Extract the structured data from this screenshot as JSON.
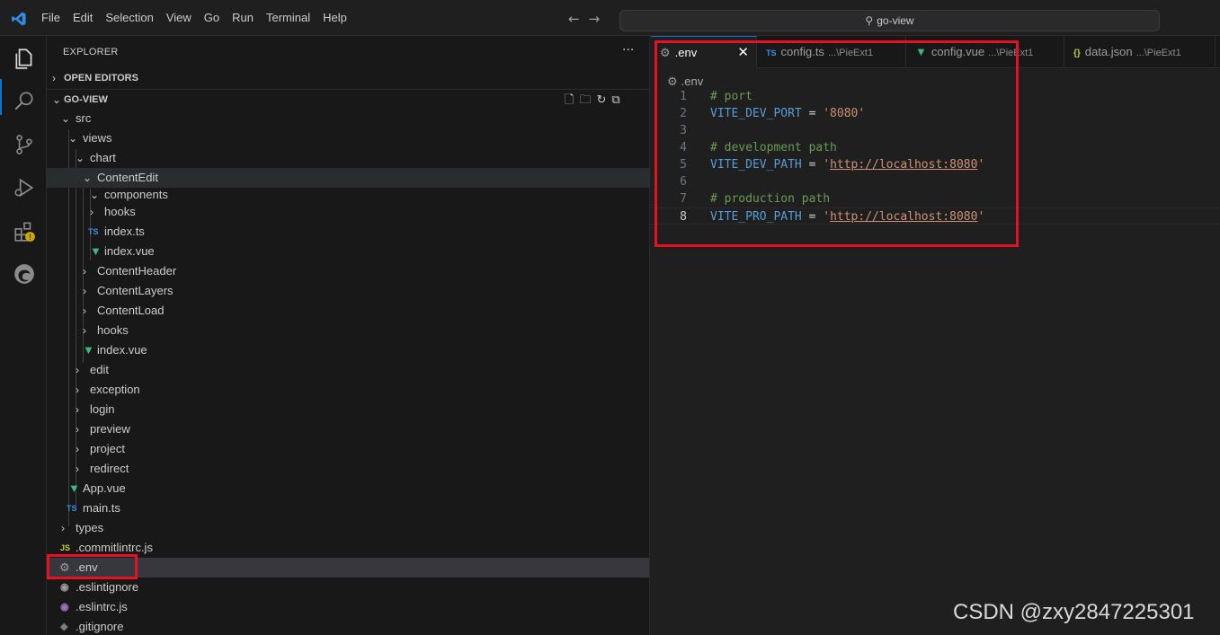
{
  "menu": [
    "File",
    "Edit",
    "Selection",
    "View",
    "Go",
    "Run",
    "Terminal",
    "Help"
  ],
  "search": {
    "text": "go-view"
  },
  "activity_icons": [
    "explorer-icon",
    "search-icon",
    "source-control-icon",
    "run-debug-icon",
    "extensions-icon",
    "edge-icon"
  ],
  "sidebar": {
    "title": "EXPLORER",
    "open_editors": "OPEN EDITORS",
    "project": "GO-VIEW",
    "tree": [
      {
        "name": "src",
        "icon": "chev-down"
      },
      {
        "name": "views",
        "icon": "chev-down"
      },
      {
        "name": "chart",
        "icon": "chev-down"
      },
      {
        "name": "ContentEdit",
        "icon": "chev-down"
      },
      {
        "name": "components",
        "icon": "chev-down"
      },
      {
        "name": "hooks",
        "icon": "chev-right"
      },
      {
        "name": "index.ts",
        "icon": "TS"
      },
      {
        "name": "index.vue",
        "icon": "vue"
      },
      {
        "name": "ContentHeader",
        "icon": "chev-right"
      },
      {
        "name": "ContentLayers",
        "icon": "chev-right"
      },
      {
        "name": "ContentLoad",
        "icon": "chev-right"
      },
      {
        "name": "hooks",
        "icon": "chev-right"
      },
      {
        "name": "index.vue",
        "icon": "vue"
      },
      {
        "name": "edit",
        "icon": "chev-right"
      },
      {
        "name": "exception",
        "icon": "chev-right"
      },
      {
        "name": "login",
        "icon": "chev-right"
      },
      {
        "name": "preview",
        "icon": "chev-right"
      },
      {
        "name": "project",
        "icon": "chev-right"
      },
      {
        "name": "redirect",
        "icon": "chev-right"
      },
      {
        "name": "App.vue",
        "icon": "vue"
      },
      {
        "name": "main.ts",
        "icon": "TS"
      },
      {
        "name": "types",
        "icon": "chev-right"
      },
      {
        "name": ".commitlintrc.js",
        "icon": "JS"
      },
      {
        "name": ".env",
        "icon": "gear"
      },
      {
        "name": ".eslintignore",
        "icon": "ring"
      },
      {
        "name": ".eslintrc.js",
        "icon": "ring-p"
      },
      {
        "name": ".gitignore",
        "icon": "diamond"
      }
    ]
  },
  "editor": {
    "tabs": [
      {
        "name": ".env",
        "path": ""
      },
      {
        "name": "config.ts",
        "path": "...\\PieExt1"
      },
      {
        "name": "config.vue",
        "path": "...\\PieExt1"
      },
      {
        "name": "data.json",
        "path": "...\\PieExt1"
      }
    ],
    "breadcrumb": ".env",
    "lines": [
      {
        "n": "1",
        "comment": "# port"
      },
      {
        "n": "2",
        "key": "VITE_DEV_PORT",
        "op": " = ",
        "value": "'8080'"
      },
      {
        "n": "3"
      },
      {
        "n": "4",
        "comment": "# development path"
      },
      {
        "n": "5",
        "key": "VITE_DEV_PATH",
        "op": " = ",
        "q1": "'",
        "url": "http://localhost:8080",
        "q2": "'"
      },
      {
        "n": "6"
      },
      {
        "n": "7",
        "comment": "# production path"
      },
      {
        "n": "8",
        "key": "VITE_PRO_PATH",
        "op": " = ",
        "q1": "'",
        "url": "http://localhost:8080",
        "q2": "'"
      }
    ]
  },
  "tab_close": "✕",
  "watermark": "CSDN @zxy2847225301"
}
